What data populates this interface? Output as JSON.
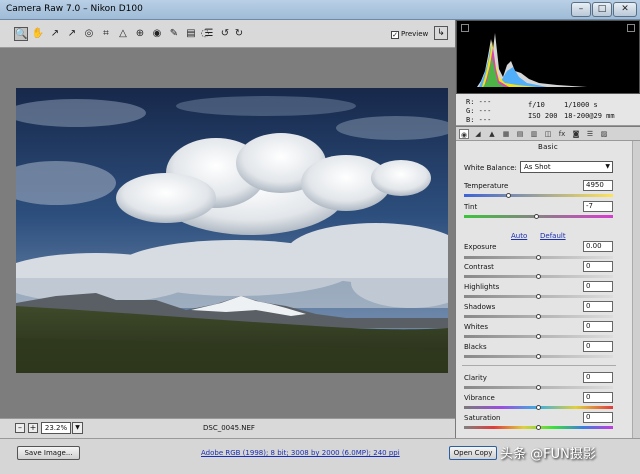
{
  "window": {
    "title": "Camera Raw 7.0  –  Nikon D100",
    "min_label": "–",
    "max_label": "□",
    "close_label": "✕"
  },
  "toolbar": {
    "tools": [
      {
        "name": "zoom-tool-icon",
        "glyph": "🔍"
      },
      {
        "name": "hand-tool-icon",
        "glyph": "✋"
      },
      {
        "name": "white-balance-tool-icon",
        "glyph": "↗"
      },
      {
        "name": "color-sampler-tool-icon",
        "glyph": "↗"
      },
      {
        "name": "target-adjustment-tool-icon",
        "glyph": "◎"
      },
      {
        "name": "crop-tool-icon",
        "glyph": "⌗"
      },
      {
        "name": "straighten-tool-icon",
        "glyph": "△"
      },
      {
        "name": "spot-removal-tool-icon",
        "glyph": "⊕"
      },
      {
        "name": "red-eye-tool-icon",
        "glyph": "◉"
      },
      {
        "name": "adjustment-brush-icon",
        "glyph": "✎"
      },
      {
        "name": "graduated-filter-icon",
        "glyph": "▤"
      },
      {
        "name": "radial-filter-icon",
        "glyph": "◌"
      },
      {
        "name": "preferences-icon",
        "glyph": "☰"
      },
      {
        "name": "rotate-left-icon",
        "glyph": "↺"
      },
      {
        "name": "rotate-right-icon",
        "glyph": "↻"
      }
    ],
    "preview_checked": "✓",
    "preview_label": "Preview",
    "fullscreen_glyph": "↳"
  },
  "canvas": {
    "zoom_minus": "–",
    "zoom_plus": "+",
    "zoom_value": "23.2%",
    "zoom_arrow": "▼",
    "file_name": "DSC_0045.NEF"
  },
  "bottom": {
    "save_label": "Save Image...",
    "workflow_text": "Adobe RGB (1998); 8 bit; 3008 by 2000 (6.0MP); 240 ppi",
    "open_label": "Open Copy",
    "watermark": "头条 @FUN摄影"
  },
  "readout": {
    "r": "R:  ---",
    "g": "G:  ---",
    "b": "B:  ---",
    "aperture": "f/10",
    "shutter": "1/1000 s",
    "iso": "ISO 200",
    "lens": "18-200@29 mm"
  },
  "tabs": [
    "◉",
    "◢",
    "▲",
    "▦",
    "▤",
    "▥",
    "◫",
    "fx",
    "◙",
    "☰",
    "▨"
  ],
  "panel": {
    "title": "Basic",
    "white_balance_label": "White Balance:",
    "white_balance_value": "As Shot",
    "temperature_label": "Temperature",
    "temperature_value": "4950",
    "tint_label": "Tint",
    "tint_value": "-7",
    "auto_label": "Auto",
    "default_label": "Default",
    "exposure_label": "Exposure",
    "exposure_value": "0.00",
    "contrast_label": "Contrast",
    "contrast_value": "0",
    "highlights_label": "Highlights",
    "highlights_value": "0",
    "shadows_label": "Shadows",
    "shadows_value": "0",
    "whites_label": "Whites",
    "whites_value": "0",
    "blacks_label": "Blacks",
    "blacks_value": "0",
    "clarity_label": "Clarity",
    "clarity_value": "0",
    "vibrance_label": "Vibrance",
    "vibrance_value": "0",
    "saturation_label": "Saturation",
    "saturation_value": "0"
  }
}
